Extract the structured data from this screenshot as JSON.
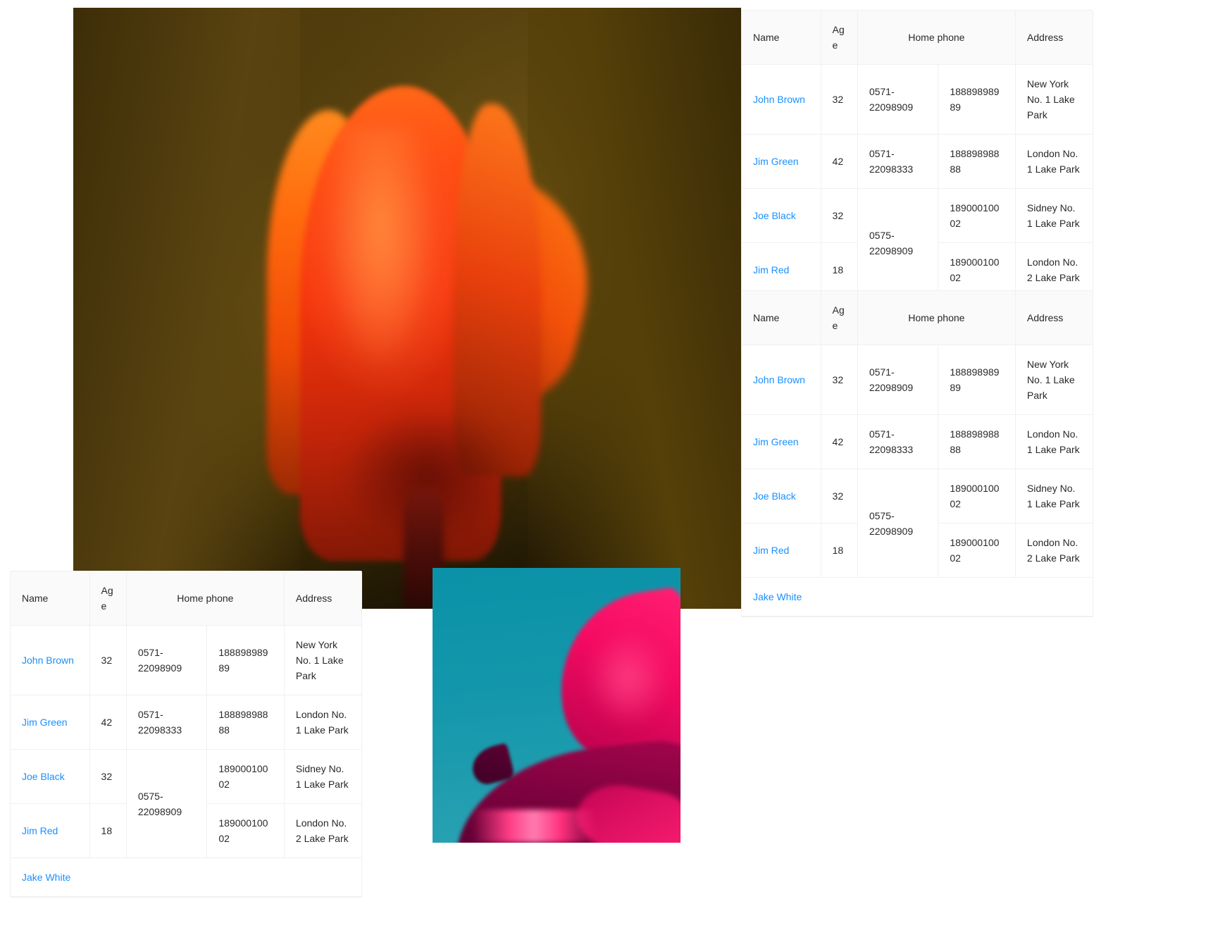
{
  "theme": {
    "link_color": "#1890ff",
    "header_bg": "#fafafa",
    "border_color": "#f0f0f0",
    "text_color": "rgba(0,0,0,0.85)"
  },
  "table": {
    "columns": {
      "name": "Name",
      "age": "Age",
      "home_phone": "Home phone",
      "address": "Address"
    },
    "rows": [
      {
        "name": "John Brown",
        "age": "32",
        "phone_group": "0571-22098909",
        "phone": "18889898989",
        "address": "New York No. 1 Lake Park"
      },
      {
        "name": "Jim Green",
        "age": "42",
        "phone_group": "0571-22098333",
        "phone": "18889898888",
        "address": "London No. 1 Lake Park"
      },
      {
        "name": "Joe Black",
        "age": "32",
        "phone_group": "0575-22098909",
        "phone": "18900010002",
        "address": "Sidney No. 1 Lake Park"
      },
      {
        "name": "Jim Red",
        "age": "18",
        "phone_group": "",
        "phone": "18900010002",
        "address": "London No. 2 Lake Park"
      }
    ],
    "footer_row": {
      "name": "Jake White"
    }
  },
  "images": {
    "tulip": {
      "alt": "orange-tulip-photo",
      "background_color": "#5a4410",
      "flower_color": "#f5350c"
    },
    "lotus": {
      "alt": "pink-lotus-photo",
      "background_color": "#1296ab",
      "flower_color": "#f50b63"
    }
  }
}
